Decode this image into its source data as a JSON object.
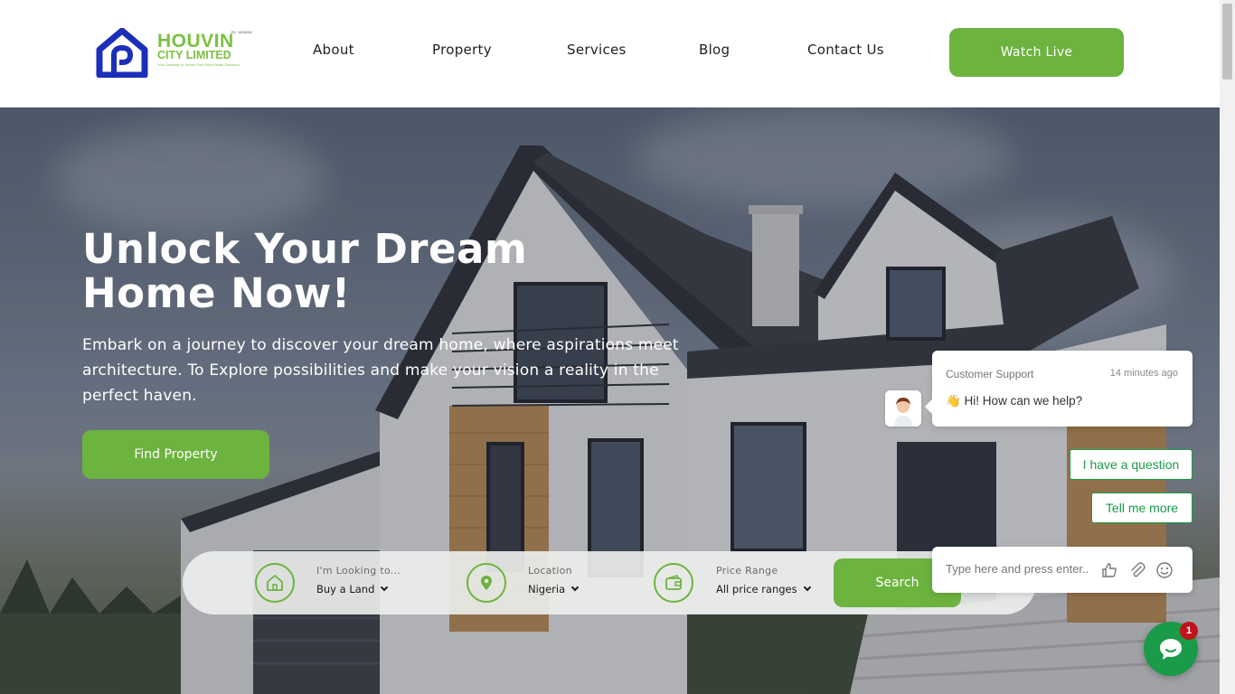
{
  "brand": {
    "name_line1": "HOUVIN",
    "name_line2": "CITY LIMITED",
    "tagline": "Your Gateway to Stress-Free Real Estate Solutions",
    "rc": "RC 1553206"
  },
  "nav": {
    "items": [
      {
        "label": "About"
      },
      {
        "label": "Property"
      },
      {
        "label": "Services"
      },
      {
        "label": "Blog"
      },
      {
        "label": "Contact Us"
      }
    ],
    "cta": "Watch Live"
  },
  "hero": {
    "title_line1": "Unlock Your Dream",
    "title_line2": "Home Now!",
    "subtitle": "Embark on a journey to discover your dream home, where aspirations meet architecture. To Explore possibilities and make your vision a reality in the perfect haven.",
    "cta": "Find Property"
  },
  "search": {
    "looking_label": "I'm Looking to...",
    "looking_value": "Buy a Land",
    "location_label": "Location",
    "location_value": "Nigeria",
    "price_label": "Price Range",
    "price_value": "All price ranges",
    "button": "Search"
  },
  "chat": {
    "from": "Customer Support",
    "time": "14 minutes ago",
    "message": "👋 Hi! How can we help?",
    "quick_replies": [
      "I have a question",
      "Tell me more"
    ],
    "input_placeholder": "Type here and press enter..",
    "badge_count": "1"
  },
  "colors": {
    "accent": "#6db33f",
    "logo_blue": "#1b2fb8",
    "chat_green": "#1a9b4a",
    "badge_red": "#c0131a"
  }
}
